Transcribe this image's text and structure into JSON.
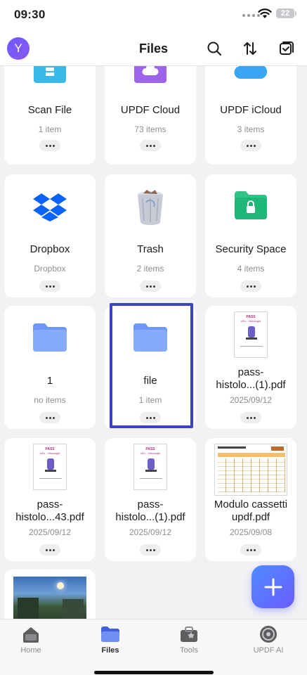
{
  "status_bar": {
    "time": "09:30",
    "battery": "22"
  },
  "header": {
    "avatar_letter": "Y",
    "title": "Files"
  },
  "items": [
    {
      "name": "Scan File",
      "sub": "1 item",
      "icon": "scan-folder-icon"
    },
    {
      "name": "UPDF Cloud",
      "sub": "73 items",
      "icon": "cloud-folder-icon"
    },
    {
      "name": "UPDF iCloud",
      "sub": "3 items",
      "icon": "icloud-icon"
    },
    {
      "name": "Dropbox",
      "sub": "Dropbox",
      "icon": "dropbox-icon"
    },
    {
      "name": "Trash",
      "sub": "2 items",
      "icon": "trash-icon"
    },
    {
      "name": "Security Space",
      "sub": "4 items",
      "icon": "security-folder-icon"
    },
    {
      "name": "1",
      "sub": "no items",
      "icon": "folder-icon"
    },
    {
      "name": "file",
      "sub": "1 item",
      "icon": "folder-icon"
    },
    {
      "name_line1": "pass-",
      "name_line2": "histolo...(1).pdf",
      "sub": "2025/09/12",
      "icon": "pdf-thumbnail"
    },
    {
      "name_line1": "pass-",
      "name_line2": "histolo...43.pdf",
      "sub": "2025/09/12",
      "icon": "pdf-thumbnail"
    },
    {
      "name_line1": "pass-",
      "name_line2": "histolo...(1).pdf",
      "sub": "2025/09/12",
      "icon": "pdf-thumbnail"
    },
    {
      "name_line1": "Modulo cassetti",
      "name_line2": "updf.pdf",
      "sub": "2025/09/08",
      "icon": "pdf-thumbnail"
    }
  ],
  "thumbnail_text": {
    "pdf_title": "PASS",
    "pdf_subtitle": "UEx - Histologie"
  },
  "tabs": [
    {
      "label": "Home",
      "icon": "home-icon"
    },
    {
      "label": "Files",
      "icon": "files-icon"
    },
    {
      "label": "Tools",
      "icon": "tools-icon"
    },
    {
      "label": "UPDF AI",
      "icon": "ai-icon"
    }
  ],
  "colors": {
    "accent": "#6a5cff",
    "highlight_border": "#3b40cf",
    "folder_blue": "#7ea4ff",
    "secure_green": "#2fc486"
  }
}
